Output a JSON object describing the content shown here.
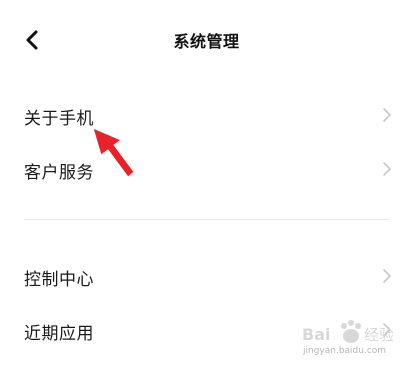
{
  "header": {
    "back_icon": "chevron-left-icon",
    "title": "系统管理"
  },
  "section1": {
    "items": [
      {
        "label": "关于手机",
        "icon": "chevron-right-icon"
      },
      {
        "label": "客户服务",
        "icon": "chevron-right-icon"
      }
    ]
  },
  "section2": {
    "items": [
      {
        "label": "控制中心",
        "icon": "chevron-right-icon"
      },
      {
        "label": "近期应用",
        "icon": "chevron-right-icon"
      }
    ]
  },
  "annotation": {
    "icon": "red-arrow-icon",
    "color": "#e8212a"
  },
  "watermark": {
    "text": "jingyan.baidu.com"
  }
}
